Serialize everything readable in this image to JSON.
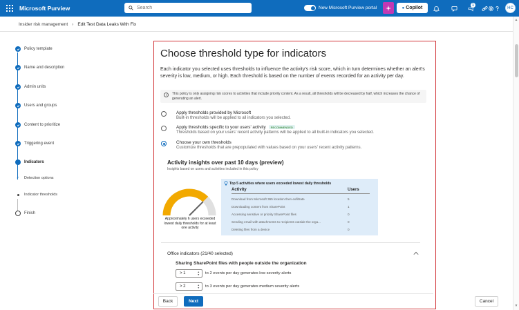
{
  "topbar": {
    "app_name": "Microsoft Purview",
    "search_placeholder": "Search",
    "toggle_label": "New Microsoft Purview portal",
    "copilot_label": "Copilot",
    "notification_count": "1",
    "avatar_initials": "HC",
    "brand_color": "#0f6cbd"
  },
  "breadcrumb": {
    "parent": "Insider risk management",
    "current": "Edit Test Data Leaks With Fix"
  },
  "stepper": {
    "steps": [
      {
        "label": "Policy template",
        "state": "done"
      },
      {
        "label": "Name and description",
        "state": "done"
      },
      {
        "label": "Admin units",
        "state": "done"
      },
      {
        "label": "Users and groups",
        "state": "done"
      },
      {
        "label": "Content to prioritize",
        "state": "done"
      },
      {
        "label": "Triggering event",
        "state": "done"
      },
      {
        "label": "Indicators",
        "state": "current"
      },
      {
        "label": "Detection options",
        "state": "substep-done"
      },
      {
        "label": "Indicator thresholds",
        "state": "substep-current"
      },
      {
        "label": "Finish",
        "state": "todo"
      }
    ]
  },
  "main": {
    "title": "Choose threshold type for indicators",
    "intro": "Each indicator you selected uses thresholds to influence the activity's risk score, which in turn determines whether an alert's severity is low, medium, or high. Each threshold is based on the number of events recorded for an activity per day.",
    "info_text": "This policy is only assigning risk scores to activities that include priority content. As a result, all thresholds will be decreased by half, which increases the chance of generating an alert.",
    "options": [
      {
        "title": "Apply thresholds provided by Microsoft",
        "desc": "Built-in thresholds will be applied to all indicators you selected.",
        "selected": false
      },
      {
        "title": "Apply thresholds specific to your users' activity",
        "badge": "RECOMMENDED",
        "desc": "Thresholds based on your users' recent activity patterns will be applied to all built-in indicators you selected.",
        "selected": false
      },
      {
        "title": "Choose your own thresholds",
        "desc": "Customize thresholds that are prepopulated with values based on your users' recent activity patterns.",
        "selected": true
      }
    ],
    "insights": {
      "title": "Activity insights over past 10 days (preview)",
      "subtitle": "Insights based on users and activities included in this policy",
      "gauge_caption": "Approximately 6 users exceeded lowest daily thresholds for at least one activity",
      "gauge_fraction": 0.75,
      "top5_title": "Top 5 activities where users exceeded lowest daily thresholds",
      "col_activity": "Activity",
      "col_users": "Users",
      "rows": [
        {
          "activity": "Download from Microsoft 365 location then exfiltrate",
          "users": "5"
        },
        {
          "activity": "Downloading content from SharePoint",
          "users": "1"
        },
        {
          "activity": "Accessing sensitive or priority SharePoint files",
          "users": "0"
        },
        {
          "activity": "Sending email with attachments to recipients outside the orga...",
          "users": "0"
        },
        {
          "activity": "Deleting files from a device",
          "users": "0"
        }
      ]
    },
    "office": {
      "accordion_title": "Office indicators (21/40 selected)",
      "section_title": "Sharing SharePoint files with people outside the organization",
      "thresholds": [
        {
          "value": "> 1",
          "text": "to 2 events per day generates low severity alerts"
        },
        {
          "value": "> 2",
          "text": "to 3 events per day generates medium severity alerts"
        }
      ]
    }
  },
  "footer": {
    "back_label": "Back",
    "next_label": "Next",
    "cancel_label": "Cancel"
  }
}
